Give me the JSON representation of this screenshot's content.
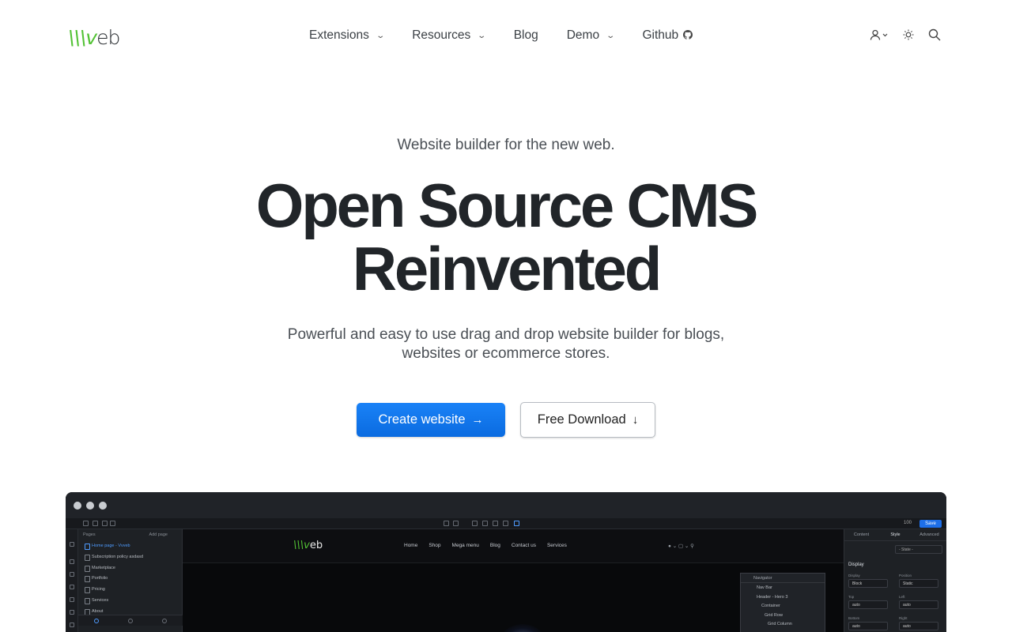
{
  "nav": {
    "logo_v": "\\\\\\v",
    "logo_rest": "eb",
    "menu": [
      {
        "label": "Extensions",
        "dropdown": true
      },
      {
        "label": "Resources",
        "dropdown": true
      },
      {
        "label": "Blog",
        "dropdown": false
      },
      {
        "label": "Demo",
        "dropdown": true
      },
      {
        "label": "Github",
        "dropdown": false
      }
    ],
    "icons": [
      "user-icon",
      "theme-toggle-icon",
      "search-icon"
    ]
  },
  "hero": {
    "tagline": "Website builder for the new web.",
    "headline_line1": "Open Source CMS",
    "headline_line2": "Reinvented",
    "subtitle": "Powerful and easy to use drag and drop website builder for blogs, websites or ecommerce stores.",
    "primary_button": "Create website",
    "secondary_button": "Free Download"
  },
  "editor": {
    "pages_title": "Pages",
    "add_page": "Add page",
    "pages": [
      "Home page - Vvveb",
      "Subscription policy asdasd",
      "Marketplace",
      "Portfolio",
      "Pricing",
      "Services",
      "About"
    ],
    "zoom": "100",
    "save": "Save",
    "site_logo_rest": "eb",
    "site_menu": [
      "Home",
      "Shop",
      "Mega menu",
      "Blog",
      "Contact us",
      "Services"
    ],
    "navigator_title": "Navigator",
    "navigator_rows": [
      "Nav Bar",
      "Header - Hero 3",
      "Container",
      "Grid Row",
      "Grid Column"
    ],
    "panel_tabs": [
      "Content",
      "Style",
      "Advanced"
    ],
    "state_select": "- State -",
    "section": "Display",
    "fields": [
      {
        "label": "Display",
        "value": "Block"
      },
      {
        "label": "Position",
        "value": "Static"
      },
      {
        "label": "Top",
        "value": "auto"
      },
      {
        "label": "Left",
        "value": "auto"
      },
      {
        "label": "Bottom",
        "value": "auto"
      },
      {
        "label": "Right",
        "value": "auto"
      }
    ]
  },
  "colors": {
    "accent": "#1a82f7",
    "logo_green": "#52c234",
    "text": "#212529"
  }
}
